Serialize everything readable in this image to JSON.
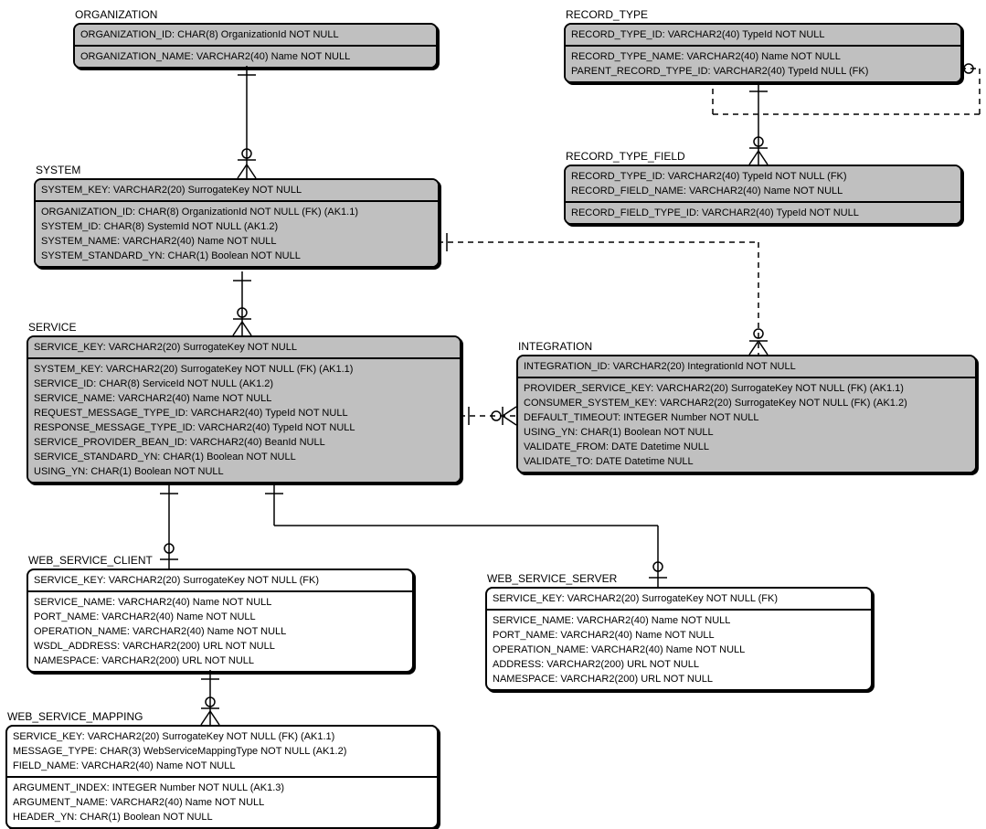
{
  "entities": {
    "organization": {
      "title": "ORGANIZATION",
      "pk": [
        "ORGANIZATION_ID: CHAR(8) OrganizationId NOT NULL"
      ],
      "attrs": [
        "ORGANIZATION_NAME: VARCHAR2(40) Name NOT NULL"
      ]
    },
    "record_type": {
      "title": "RECORD_TYPE",
      "pk": [
        "RECORD_TYPE_ID: VARCHAR2(40) TypeId NOT NULL"
      ],
      "attrs": [
        "RECORD_TYPE_NAME: VARCHAR2(40) Name NOT NULL",
        "PARENT_RECORD_TYPE_ID: VARCHAR2(40) TypeId NULL (FK)"
      ]
    },
    "record_type_field": {
      "title": "RECORD_TYPE_FIELD",
      "pk": [
        "RECORD_TYPE_ID: VARCHAR2(40) TypeId NOT NULL (FK)",
        "RECORD_FIELD_NAME: VARCHAR2(40) Name NOT NULL"
      ],
      "attrs": [
        "RECORD_FIELD_TYPE_ID: VARCHAR2(40) TypeId NOT NULL"
      ]
    },
    "system": {
      "title": "SYSTEM",
      "pk": [
        "SYSTEM_KEY: VARCHAR2(20) SurrogateKey NOT NULL"
      ],
      "attrs": [
        "ORGANIZATION_ID: CHAR(8) OrganizationId NOT NULL (FK) (AK1.1)",
        "SYSTEM_ID: CHAR(8) SystemId NOT NULL (AK1.2)",
        "SYSTEM_NAME: VARCHAR2(40) Name NOT NULL",
        "SYSTEM_STANDARD_YN: CHAR(1) Boolean NOT NULL"
      ]
    },
    "service": {
      "title": "SERVICE",
      "pk": [
        "SERVICE_KEY: VARCHAR2(20) SurrogateKey NOT NULL"
      ],
      "attrs": [
        "SYSTEM_KEY: VARCHAR2(20) SurrogateKey NOT NULL (FK) (AK1.1)",
        "SERVICE_ID: CHAR(8) ServiceId NOT NULL (AK1.2)",
        "SERVICE_NAME: VARCHAR2(40) Name NOT NULL",
        "REQUEST_MESSAGE_TYPE_ID: VARCHAR2(40) TypeId NOT NULL",
        "RESPONSE_MESSAGE_TYPE_ID: VARCHAR2(40) TypeId NOT NULL",
        "SERVICE_PROVIDER_BEAN_ID: VARCHAR2(40) BeanId NULL",
        "SERVICE_STANDARD_YN: CHAR(1) Boolean NOT NULL",
        "USING_YN: CHAR(1) Boolean NOT NULL"
      ]
    },
    "integration": {
      "title": "INTEGRATION",
      "pk": [
        "INTEGRATION_ID: VARCHAR2(20) IntegrationId NOT NULL"
      ],
      "attrs": [
        "PROVIDER_SERVICE_KEY: VARCHAR2(20) SurrogateKey NOT NULL (FK) (AK1.1)",
        "CONSUMER_SYSTEM_KEY: VARCHAR2(20) SurrogateKey NOT NULL (FK) (AK1.2)",
        "DEFAULT_TIMEOUT: INTEGER Number NOT NULL",
        "USING_YN: CHAR(1) Boolean NOT NULL",
        "VALIDATE_FROM: DATE Datetime NULL",
        "VALIDATE_TO: DATE Datetime NULL"
      ]
    },
    "web_service_client": {
      "title": "WEB_SERVICE_CLIENT",
      "pk": [
        "SERVICE_KEY: VARCHAR2(20) SurrogateKey NOT NULL (FK)"
      ],
      "attrs": [
        "SERVICE_NAME: VARCHAR2(40) Name NOT NULL",
        "PORT_NAME: VARCHAR2(40) Name NOT NULL",
        "OPERATION_NAME: VARCHAR2(40) Name NOT NULL",
        "WSDL_ADDRESS: VARCHAR2(200) URL NOT NULL",
        "NAMESPACE: VARCHAR2(200) URL NOT NULL"
      ]
    },
    "web_service_server": {
      "title": "WEB_SERVICE_SERVER",
      "pk": [
        "SERVICE_KEY: VARCHAR2(20) SurrogateKey NOT NULL (FK)"
      ],
      "attrs": [
        "SERVICE_NAME: VARCHAR2(40) Name NOT NULL",
        "PORT_NAME: VARCHAR2(40) Name NOT NULL",
        "OPERATION_NAME: VARCHAR2(40) Name NOT NULL",
        "ADDRESS: VARCHAR2(200) URL NOT NULL",
        "NAMESPACE: VARCHAR2(200) URL NOT NULL"
      ]
    },
    "web_service_mapping": {
      "title": "WEB_SERVICE_MAPPING",
      "pk": [
        "SERVICE_KEY: VARCHAR2(20) SurrogateKey NOT NULL (FK) (AK1.1)",
        "MESSAGE_TYPE: CHAR(3) WebServiceMappingType NOT NULL (AK1.2)",
        "FIELD_NAME: VARCHAR2(40) Name NOT NULL"
      ],
      "attrs": [
        "ARGUMENT_INDEX: INTEGER Number NOT NULL (AK1.3)",
        "ARGUMENT_NAME: VARCHAR2(40) Name NOT NULL",
        "HEADER_YN: CHAR(1) Boolean NOT NULL"
      ]
    }
  },
  "chart_data": {
    "type": "erd",
    "entities": [
      "ORGANIZATION",
      "RECORD_TYPE",
      "RECORD_TYPE_FIELD",
      "SYSTEM",
      "SERVICE",
      "INTEGRATION",
      "WEB_SERVICE_CLIENT",
      "WEB_SERVICE_SERVER",
      "WEB_SERVICE_MAPPING"
    ],
    "relationships": [
      {
        "from": "ORGANIZATION",
        "to": "SYSTEM",
        "type": "identifying-one-to-many"
      },
      {
        "from": "SYSTEM",
        "to": "SERVICE",
        "type": "identifying-one-to-many"
      },
      {
        "from": "SYSTEM",
        "to": "INTEGRATION",
        "type": "non-identifying-one-to-many"
      },
      {
        "from": "SERVICE",
        "to": "INTEGRATION",
        "type": "non-identifying-one-to-many"
      },
      {
        "from": "SERVICE",
        "to": "WEB_SERVICE_CLIENT",
        "type": "identifying-one-to-zero-or-one"
      },
      {
        "from": "SERVICE",
        "to": "WEB_SERVICE_SERVER",
        "type": "identifying-one-to-zero-or-one"
      },
      {
        "from": "WEB_SERVICE_CLIENT",
        "to": "WEB_SERVICE_MAPPING",
        "type": "identifying-one-to-many"
      },
      {
        "from": "RECORD_TYPE",
        "to": "RECORD_TYPE_FIELD",
        "type": "identifying-one-to-many"
      },
      {
        "from": "RECORD_TYPE",
        "to": "RECORD_TYPE",
        "type": "self-non-identifying"
      },
      {
        "from": "RECORD_TYPE_FIELD",
        "to": "INTEGRATION",
        "type": "non-identifying-one-to-many"
      }
    ]
  }
}
